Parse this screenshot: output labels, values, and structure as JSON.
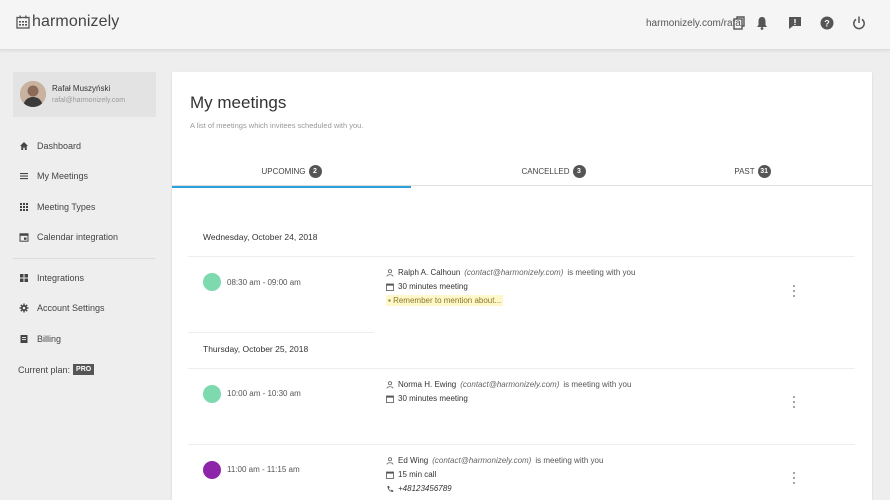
{
  "app": {
    "name": "harmonizely",
    "url": "harmonizely.com/rafal"
  },
  "user": {
    "name": "Rafał Muszyński",
    "email": "rafal@harmonizely.com"
  },
  "sidebar": {
    "items": [
      {
        "label": "Dashboard",
        "icon": "home-icon"
      },
      {
        "label": "My Meetings",
        "icon": "list-icon"
      },
      {
        "label": "Meeting Types",
        "icon": "grid-icon"
      },
      {
        "label": "Calendar integration",
        "icon": "calendar-icon"
      },
      {
        "label": "Integrations",
        "icon": "puzzle-icon"
      },
      {
        "label": "Account Settings",
        "icon": "gear-icon"
      },
      {
        "label": "Billing",
        "icon": "receipt-icon"
      }
    ],
    "plan_label": "Current plan:",
    "plan_badge": "PRO"
  },
  "main": {
    "title": "My meetings",
    "subtitle": "A list of meetings which invitees scheduled with you.",
    "tabs": [
      {
        "label": "UPCOMING",
        "count": "2",
        "active": true
      },
      {
        "label": "CANCELLED",
        "count": "3",
        "active": false
      },
      {
        "label": "PAST",
        "count": "31",
        "active": false
      }
    ],
    "days": [
      {
        "date": "Wednesday, October 24, 2018",
        "meetings": [
          {
            "time": "08:30 am - 09:00 am",
            "color": "#7dd9ae",
            "invitee": "Ralph A. Calhoun",
            "email": "(contact@harmonizely.com)",
            "rest": "is meeting with you",
            "type": "30 minutes meeting",
            "note": "Remember to mention about..."
          }
        ]
      },
      {
        "date": "Thursday, October 25, 2018",
        "meetings": [
          {
            "time": "10:00 am - 10:30 am",
            "color": "#7dd9ae",
            "invitee": "Norma H. Ewing",
            "email": "(contact@harmonizely.com)",
            "rest": "is meeting with you",
            "type": "30 minutes meeting"
          },
          {
            "time": "11:00 am - 11:15 am",
            "color": "#8e24aa",
            "invitee": "Ed Wing",
            "email": "(contact@harmonizely.com)",
            "rest": "is meeting with you",
            "type": "15 min call",
            "phone": "+48123456789"
          }
        ]
      }
    ]
  },
  "colors": {
    "accent": "#2b9fd9",
    "badge": "#555555",
    "note_bg": "#fdf7c9"
  }
}
